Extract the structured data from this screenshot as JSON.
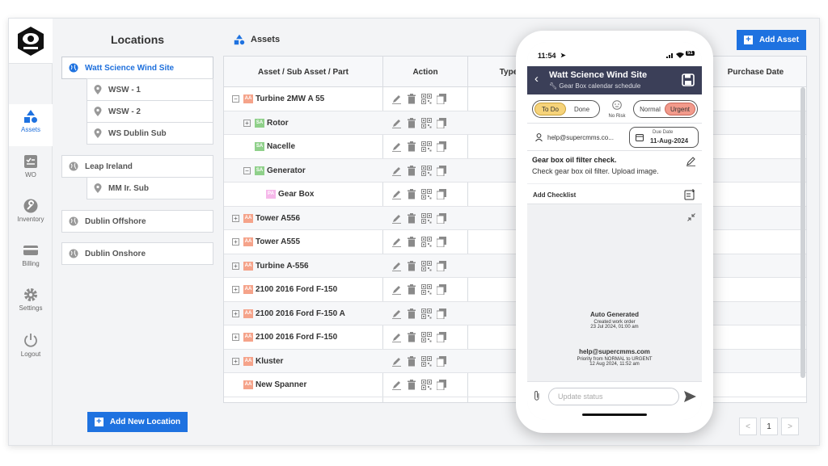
{
  "sidebar": {
    "items": [
      {
        "label": "Assets",
        "icon": "assets-icon"
      },
      {
        "label": "WO",
        "icon": "work-order-icon"
      },
      {
        "label": "Inventory",
        "icon": "wrench-icon"
      },
      {
        "label": "Billing",
        "icon": "card-icon"
      },
      {
        "label": "Settings",
        "icon": "gear-icon"
      },
      {
        "label": "Logout",
        "icon": "power-icon"
      }
    ]
  },
  "locations": {
    "title": "Locations",
    "items": [
      {
        "label": "Watt Science Wind Site",
        "type": "site"
      },
      {
        "label": "WSW - 1",
        "type": "sub"
      },
      {
        "label": "WSW - 2",
        "type": "sub"
      },
      {
        "label": "WS Dublin Sub",
        "type": "sub"
      },
      {
        "label": "Leap Ireland",
        "type": "site"
      },
      {
        "label": "MM Ir. Sub",
        "type": "sub"
      },
      {
        "label": "Dublin Offshore",
        "type": "site"
      },
      {
        "label": "Dublin Onshore",
        "type": "site"
      }
    ],
    "add_label": "Add New Location"
  },
  "assets": {
    "title": "Assets",
    "add_label": "Add Asset",
    "columns": [
      "Asset / Sub Asset / Part",
      "Action",
      "Type",
      "Purchase Date"
    ],
    "rows": [
      {
        "name": "Turbine 2MW A 55",
        "badge": "AA",
        "expander": "−"
      },
      {
        "name": "Rotor",
        "badge": "SA",
        "expander": "+"
      },
      {
        "name": "Nacelle",
        "badge": "SA",
        "expander": ""
      },
      {
        "name": "Generator",
        "badge": "SA",
        "expander": "−"
      },
      {
        "name": "Gear Box",
        "badge": "PA",
        "expander": ""
      },
      {
        "name": "Tower A556",
        "badge": "AA",
        "expander": "+"
      },
      {
        "name": "Tower A555",
        "badge": "AA",
        "expander": "+"
      },
      {
        "name": "Turbine A-556",
        "badge": "AA",
        "expander": "+"
      },
      {
        "name": "2100 2016 Ford F-150",
        "badge": "AA",
        "expander": "+"
      },
      {
        "name": "2100 2016 Ford F-150 A",
        "badge": "AA",
        "expander": "+"
      },
      {
        "name": "2100 2016 Ford F-150",
        "badge": "AA",
        "expander": "+"
      },
      {
        "name": "Kluster",
        "badge": "AA",
        "expander": "+"
      },
      {
        "name": "New Spanner",
        "badge": "AA",
        "expander": ""
      }
    ]
  },
  "pagination": {
    "prev": "<",
    "page": "1",
    "next": ">"
  },
  "phone": {
    "time": "11:54",
    "title": "Watt Science Wind Site",
    "subtitle": "Gear Box calendar schedule",
    "status_todo": "To Do",
    "status_done": "Done",
    "risk_label": "No Risk",
    "priority_normal": "Normal",
    "priority_urgent": "Urgent",
    "assignee": "help@supercmms.co...",
    "due_label": "Due Date",
    "due_date": "11-Aug-2024",
    "task_title": "Gear box oil filter check.",
    "task_desc": "Check gear box oil filter. Upload image.",
    "add_checklist": "Add Checklist",
    "log1_title": "Auto Generated",
    "log1_line1": "Created work order",
    "log1_line2": "23 Jul 2024, 01:00 am",
    "log2_title": "help@supercmms.com",
    "log2_line1": "Priority from NORMAL to URGENT",
    "log2_line2": "12 Aug 2024, 11:52 am",
    "composer_placeholder": "Update status",
    "battery": "51"
  },
  "colors": {
    "accent": "#1e72e0",
    "header_dark": "#3b3f58",
    "todo_bg": "#f6d37a",
    "urgent_bg": "#f29a8b",
    "badge_asset": "#f5a38a",
    "badge_sub": "#8fd08a",
    "badge_part": "#f6b8ea"
  }
}
